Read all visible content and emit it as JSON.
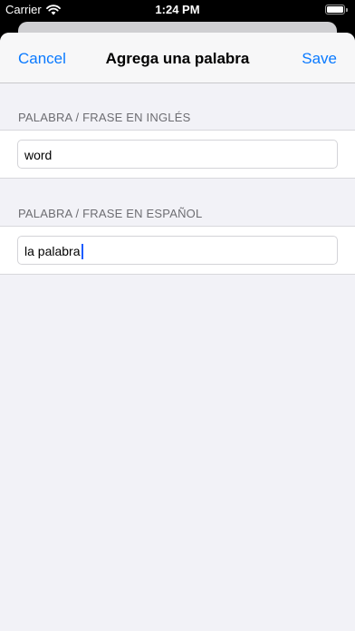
{
  "status_bar": {
    "carrier": "Carrier",
    "time": "1:24 PM"
  },
  "nav": {
    "cancel_label": "Cancel",
    "title": "Agrega una palabra",
    "save_label": "Save"
  },
  "form": {
    "english": {
      "header": "PALABRA / FRASE EN INGLÉS",
      "value": "word"
    },
    "spanish": {
      "header": "PALABRA / FRASE EN ESPAÑOL",
      "value": "la palabra"
    }
  },
  "colors": {
    "accent": "#0a7aff",
    "caret": "#1a5cff"
  },
  "icons": {
    "wifi": "wifi-icon",
    "battery": "battery-icon"
  }
}
